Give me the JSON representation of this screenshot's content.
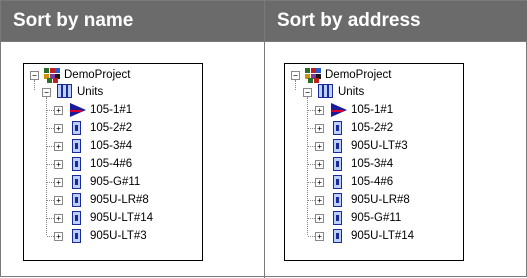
{
  "left": {
    "header": "Sort by name",
    "tree": {
      "root": "DemoProject",
      "group": "Units",
      "items": [
        "105-1#1",
        "105-2#2",
        "105-3#4",
        "105-4#6",
        "905-G#11",
        "905U-LR#8",
        "905U-LT#14",
        "905U-LT#3"
      ]
    }
  },
  "right": {
    "header": "Sort by address",
    "tree": {
      "root": "DemoProject",
      "group": "Units",
      "items": [
        "105-1#1",
        "105-2#2",
        "905U-LT#3",
        "105-3#4",
        "105-4#6",
        "905U-LR#8",
        "905-G#11",
        "905U-LT#14"
      ]
    }
  },
  "colors": {
    "header_bg": "#6b6b6b",
    "header_text": "#ffffff",
    "icon_blue": "#1a2a9a",
    "arrow_red": "#d6002a"
  },
  "icons": {
    "root": "project-icon",
    "group": "units-icon",
    "first_item": "selected-arrow-icon",
    "item": "unit-icon"
  }
}
